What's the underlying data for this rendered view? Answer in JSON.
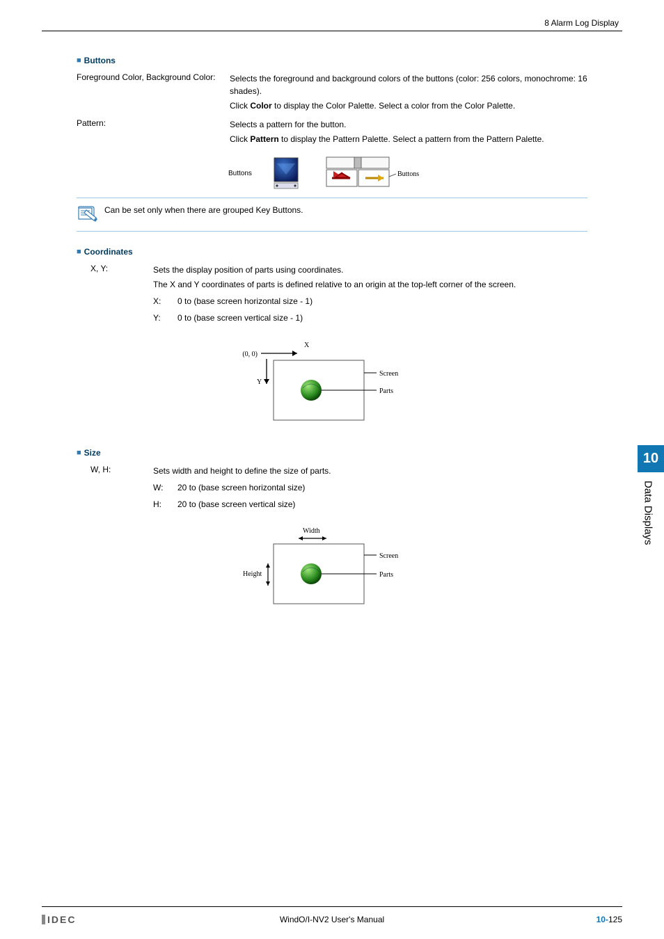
{
  "header": {
    "right": "8 Alarm Log Display"
  },
  "sec_buttons": {
    "heading": "Buttons",
    "rows": [
      {
        "term": "Foreground Color, Background Color:",
        "desc": [
          {
            "pre": "Selects the foreground and background colors of the buttons (color: 256 colors, monochrome: 16 shades)."
          },
          {
            "pre": "Click ",
            "bold": "Color",
            "post": " to display the Color Palette. Select a color from the Color Palette."
          }
        ]
      },
      {
        "term": "Pattern:",
        "desc": [
          {
            "pre": "Selects a pattern for the button."
          },
          {
            "pre": "Click ",
            "bold": "Pattern",
            "post": " to display the Pattern Palette. Select a pattern from the Pattern Palette."
          }
        ]
      }
    ],
    "illus": {
      "leftLabel": "Buttons",
      "rightLabel": "Buttons"
    },
    "note": "Can be set only when there are grouped Key Buttons."
  },
  "sec_coords": {
    "heading": "Coordinates",
    "term": "X, Y:",
    "desc": [
      "Sets the display position of parts using coordinates.",
      "The X and Y coordinates of parts is defined relative to an origin at the top-left corner of the screen."
    ],
    "sublist": [
      {
        "k": "X:",
        "v": "0 to (base screen horizontal size - 1)"
      },
      {
        "k": "Y:",
        "v": "0 to (base screen vertical size - 1)"
      }
    ],
    "diagram": {
      "origin": "(0, 0)",
      "x": "X",
      "y": "Y",
      "screen": "Screen",
      "parts": "Parts"
    }
  },
  "sec_size": {
    "heading": "Size",
    "term": "W, H:",
    "desc": [
      "Sets width and height to define the size of parts."
    ],
    "sublist": [
      {
        "k": "W:",
        "v": "20 to (base screen horizontal size)"
      },
      {
        "k": "H:",
        "v": "20 to (base screen vertical size)"
      }
    ],
    "diagram": {
      "width": "Width",
      "height": "Height",
      "screen": "Screen",
      "parts": "Parts"
    }
  },
  "sidebar": {
    "num": "10",
    "label": "Data Displays"
  },
  "footer": {
    "logo": "IDEC",
    "center": "WindO/I-NV2 User's Manual",
    "chapter": "10-",
    "page": "125"
  }
}
